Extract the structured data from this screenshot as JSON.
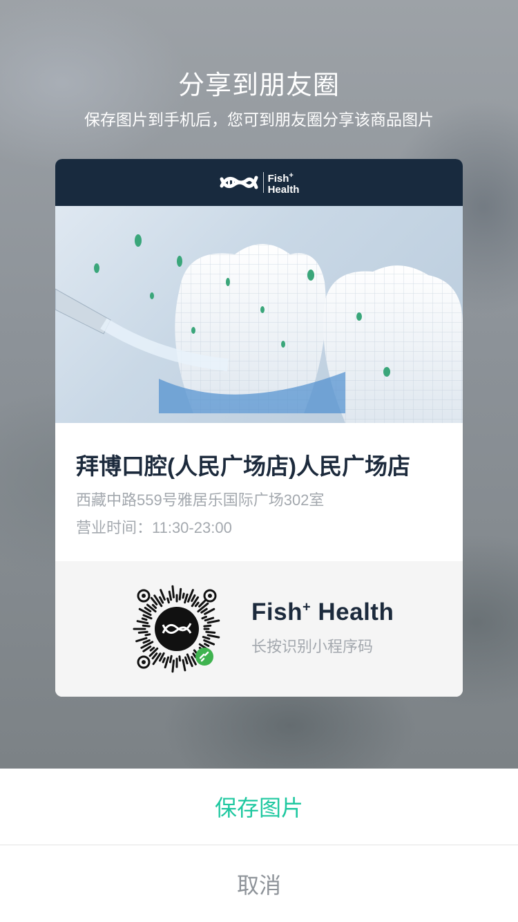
{
  "modal": {
    "title": "分享到朋友圈",
    "subtitle": "保存图片到手机后，您可到朋友圈分享该商品图片"
  },
  "card": {
    "header": {
      "brand_name": "Fish",
      "brand_plus": "+",
      "brand_name_2": "Health"
    },
    "store": {
      "name": "拜博口腔(人民广场店)人民广场店",
      "address": "西藏中路559号雅居乐国际广场302室",
      "hours": "营业时间：11:30-23:00"
    },
    "mini_program": {
      "name": "Fish",
      "name_plus": "+",
      "name_2": " Health",
      "hint": "长按识别小程序码"
    }
  },
  "actions": {
    "save_label": "保存图片",
    "cancel_label": "取消"
  },
  "colors": {
    "header_bg": "#182a3e",
    "accent": "#1fc8a0",
    "wechat_green": "#3fb34f",
    "text_dark": "#1c2a3c",
    "text_muted": "#a3a8ae"
  }
}
